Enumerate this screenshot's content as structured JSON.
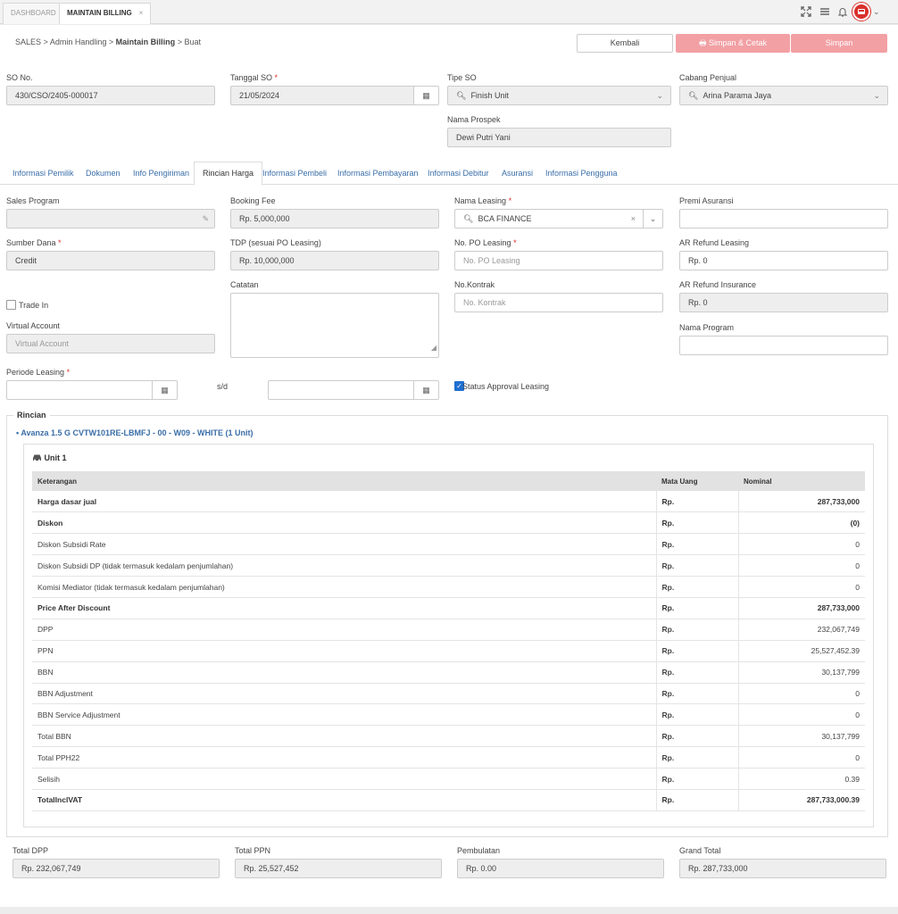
{
  "topbar": {
    "tabs": [
      {
        "label": "DASHBOARD"
      },
      {
        "label": "MAINTAIN BILLING"
      }
    ],
    "close_glyph": "×"
  },
  "breadcrumb": {
    "items": [
      "SALES",
      "Admin Handling",
      "Maintain Billing",
      "Buat"
    ],
    "sep": ">"
  },
  "actions": {
    "back": "Kembali",
    "save_print": "Simpan & Cetak",
    "save": "Simpan"
  },
  "header": {
    "so_no": {
      "label": "SO No.",
      "value": "430/CSO/2405-000017"
    },
    "tanggal_so": {
      "label": "Tanggal SO",
      "value": "21/05/2024"
    },
    "tipe_so": {
      "label": "Tipe SO",
      "value": "Finish Unit"
    },
    "cabang": {
      "label": "Cabang Penjual",
      "value": "Arina Parama Jaya"
    },
    "prospek": {
      "label": "Nama Prospek",
      "value": "Dewi Putri Yani"
    }
  },
  "form_tabs": [
    "Informasi Pemilik",
    "Dokumen",
    "Info Pengiriman",
    "Rincian Harga",
    "Informasi Pembeli",
    "Informasi Pembayaran",
    "Informasi Debitur",
    "Asuransi",
    "Informasi Pengguna"
  ],
  "active_tab": "Rincian Harga",
  "fields": {
    "sales_program": {
      "label": "Sales Program",
      "value": ""
    },
    "booking_fee": {
      "label": "Booking Fee",
      "value": "Rp. 5,000,000"
    },
    "nama_leasing": {
      "label": "Nama Leasing",
      "value": "BCA FINANCE"
    },
    "premi": {
      "label": "Premi Asuransi",
      "value": ""
    },
    "sumber_dana": {
      "label": "Sumber Dana",
      "value": "Credit"
    },
    "tdp": {
      "label": "TDP (sesuai PO Leasing)",
      "value": "Rp. 10,000,000"
    },
    "no_po": {
      "label": "No. PO Leasing",
      "placeholder": "No. PO Leasing"
    },
    "ar_refund_leasing": {
      "label": "AR Refund Leasing",
      "value": "Rp. 0"
    },
    "catatan": {
      "label": "Catatan"
    },
    "no_kontrak": {
      "label": "No.Kontrak",
      "placeholder": "No. Kontrak"
    },
    "ar_refund_ins": {
      "label": "AR Refund Insurance",
      "value": "Rp. 0"
    },
    "trade_in": {
      "label": "Trade In"
    },
    "virtual_account": {
      "label": "Virtual Account",
      "placeholder": "Virtual Account"
    },
    "nama_program": {
      "label": "Nama Program",
      "value": ""
    },
    "periode": {
      "label": "Periode Leasing",
      "sd": "s/d"
    },
    "status_approval": {
      "label": "Status Approval Leasing",
      "checked": true
    }
  },
  "rincian": {
    "legend": "Rincian",
    "unit_link": "Avanza 1.5 G CVTW101RE-LBMFJ - 00 - W09 - WHITE  (1 Unit)",
    "unit_title": "Unit 1",
    "columns": [
      "Keterangan",
      "Mata Uang",
      "Nominal"
    ],
    "rows": [
      {
        "label": "Harga dasar jual",
        "cur": "Rp.",
        "val": "287,733,000",
        "bold": true
      },
      {
        "label": "Diskon",
        "cur": "Rp.",
        "val": "(0)",
        "bold": true
      },
      {
        "label": "Diskon Subsidi Rate",
        "cur": "Rp.",
        "val": "0",
        "bold": false
      },
      {
        "label": "Diskon Subsidi DP (tidak termasuk kedalam penjumlahan)",
        "cur": "Rp.",
        "val": "0",
        "bold": false
      },
      {
        "label": "Komisi Mediator (tidak termasuk kedalam penjumlahan)",
        "cur": "Rp.",
        "val": "0",
        "bold": false
      },
      {
        "label": "Price After Discount",
        "cur": "Rp.",
        "val": "287,733,000",
        "bold": true
      },
      {
        "label": "DPP",
        "cur": "Rp.",
        "val": "232,067,749",
        "bold": false
      },
      {
        "label": "PPN",
        "cur": "Rp.",
        "val": "25,527,452.39",
        "bold": false
      },
      {
        "label": "BBN",
        "cur": "Rp.",
        "val": "30,137,799",
        "bold": false
      },
      {
        "label": "BBN Adjustment",
        "cur": "Rp.",
        "val": "0",
        "bold": false
      },
      {
        "label": "BBN Service Adjustment",
        "cur": "Rp.",
        "val": "0",
        "bold": false
      },
      {
        "label": "Total BBN",
        "cur": "Rp.",
        "val": "30,137,799",
        "bold": false
      },
      {
        "label": "Total PPH22",
        "cur": "Rp.",
        "val": "0",
        "bold": false
      },
      {
        "label": "Selisih",
        "cur": "Rp.",
        "val": "0.39",
        "bold": false
      },
      {
        "label": "TotalInclVAT",
        "cur": "Rp.",
        "val": "287,733,000.39",
        "bold": true
      }
    ]
  },
  "totals": [
    {
      "label": "Total DPP",
      "value": "Rp. 232,067,749"
    },
    {
      "label": "Total PPN",
      "value": "Rp. 25,527,452"
    },
    {
      "label": "Pembulatan",
      "value": "Rp. 0.00"
    },
    {
      "label": "Grand Total",
      "value": "Rp. 287,733,000"
    }
  ],
  "colors": {
    "accent": "#3a6ea8",
    "danger": "#d9302c",
    "pink": "#f2a0a4"
  }
}
